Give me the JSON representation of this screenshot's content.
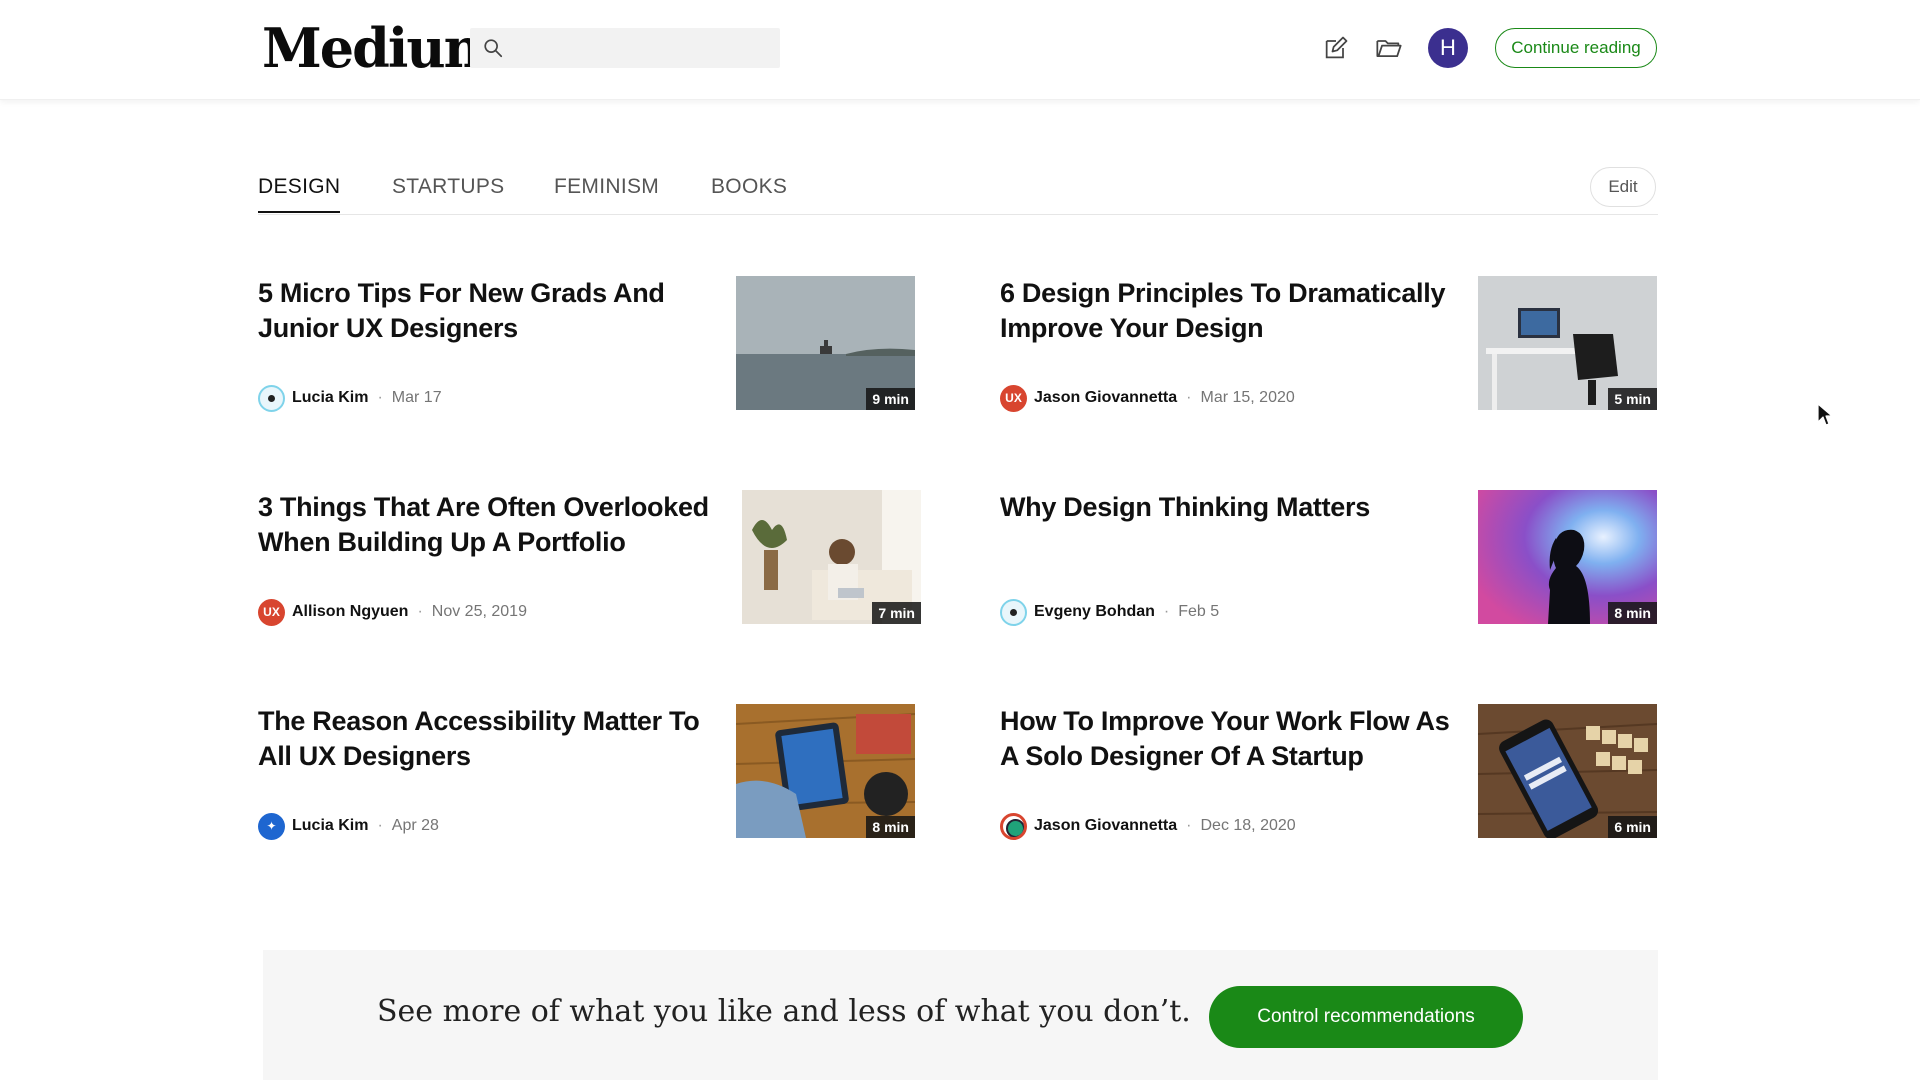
{
  "header": {
    "logo": "Medium",
    "search_placeholder": "",
    "avatar_letter": "H",
    "continue_label": "Continue reading"
  },
  "tabs": {
    "items": [
      "DESIGN",
      "STARTUPS",
      "FEMINISM",
      "BOOKS"
    ],
    "active": "DESIGN",
    "edit_label": "Edit"
  },
  "articles": [
    {
      "title": "5 Micro Tips For New Grads And Junior UX Designers",
      "author": "Lucia Kim",
      "date": "Mar 17",
      "read_time": "9 min",
      "avatar": "eye-icon"
    },
    {
      "title": "6 Design Principles To Dramatically Improve Your Design",
      "author": "Jason Giovannetta",
      "date": "Mar 15, 2020",
      "read_time": "5 min",
      "avatar": "ux-badge-icon",
      "avatar_text": "UX"
    },
    {
      "title": "3 Things That Are Often Overlooked When Building Up A Portfolio",
      "author": "Allison Ngyuen",
      "date": "Nov 25, 2019",
      "read_time": "7 min",
      "avatar": "ux-badge-icon",
      "avatar_text": "UX"
    },
    {
      "title": "Why Design Thinking Matters",
      "author": "Evgeny Bohdan",
      "date": "Feb 5",
      "read_time": "8 min",
      "avatar": "eye-icon"
    },
    {
      "title": "The Reason Accessibility Matter To All UX Designers",
      "author": "Lucia Kim",
      "date": "Apr 28",
      "read_time": "8 min",
      "avatar": "compass-icon"
    },
    {
      "title": "How To Improve Your Work Flow As A Solo Designer Of A Startup",
      "author": "Jason Giovannetta",
      "date": "Dec 18, 2020",
      "read_time": "6 min",
      "avatar": "ring-icon"
    }
  ],
  "banner": {
    "text": "See more of what you like and less of what you don’t.",
    "button_label": "Control recommendations"
  },
  "colors": {
    "brand_green": "#1a8917",
    "avatar_purple": "#3b2f8f"
  }
}
